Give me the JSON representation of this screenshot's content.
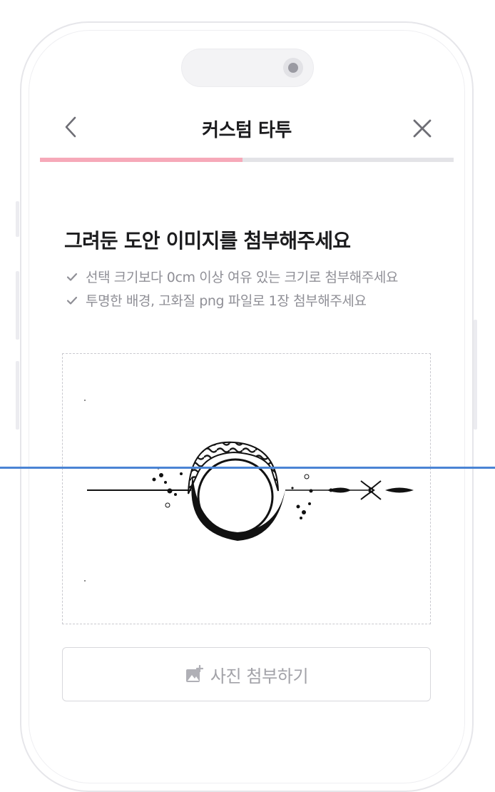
{
  "header": {
    "title": "커스텀 타투",
    "back_icon": "chevron-left-icon",
    "close_icon": "close-icon"
  },
  "progress": {
    "fraction": 0.49,
    "fill_color": "#f6a9b9",
    "track_color": "#e3e3e7"
  },
  "main": {
    "headline": "그려둔 도안 이미지를 첨부해주세요",
    "checks": [
      "선택 크기보다 0cm 이상 여유 있는 크기로 첨부해주세요",
      "투명한 배경, 고화질 png 파일로 1장 첨부해주세요"
    ]
  },
  "upload": {
    "image": "tattoo-design-image"
  },
  "attach_button": {
    "label": "사진 첨부하기",
    "icon": "add-photo-icon"
  },
  "colors": {
    "accent": "#f6a9b9",
    "guide_line": "#4a84d4"
  }
}
